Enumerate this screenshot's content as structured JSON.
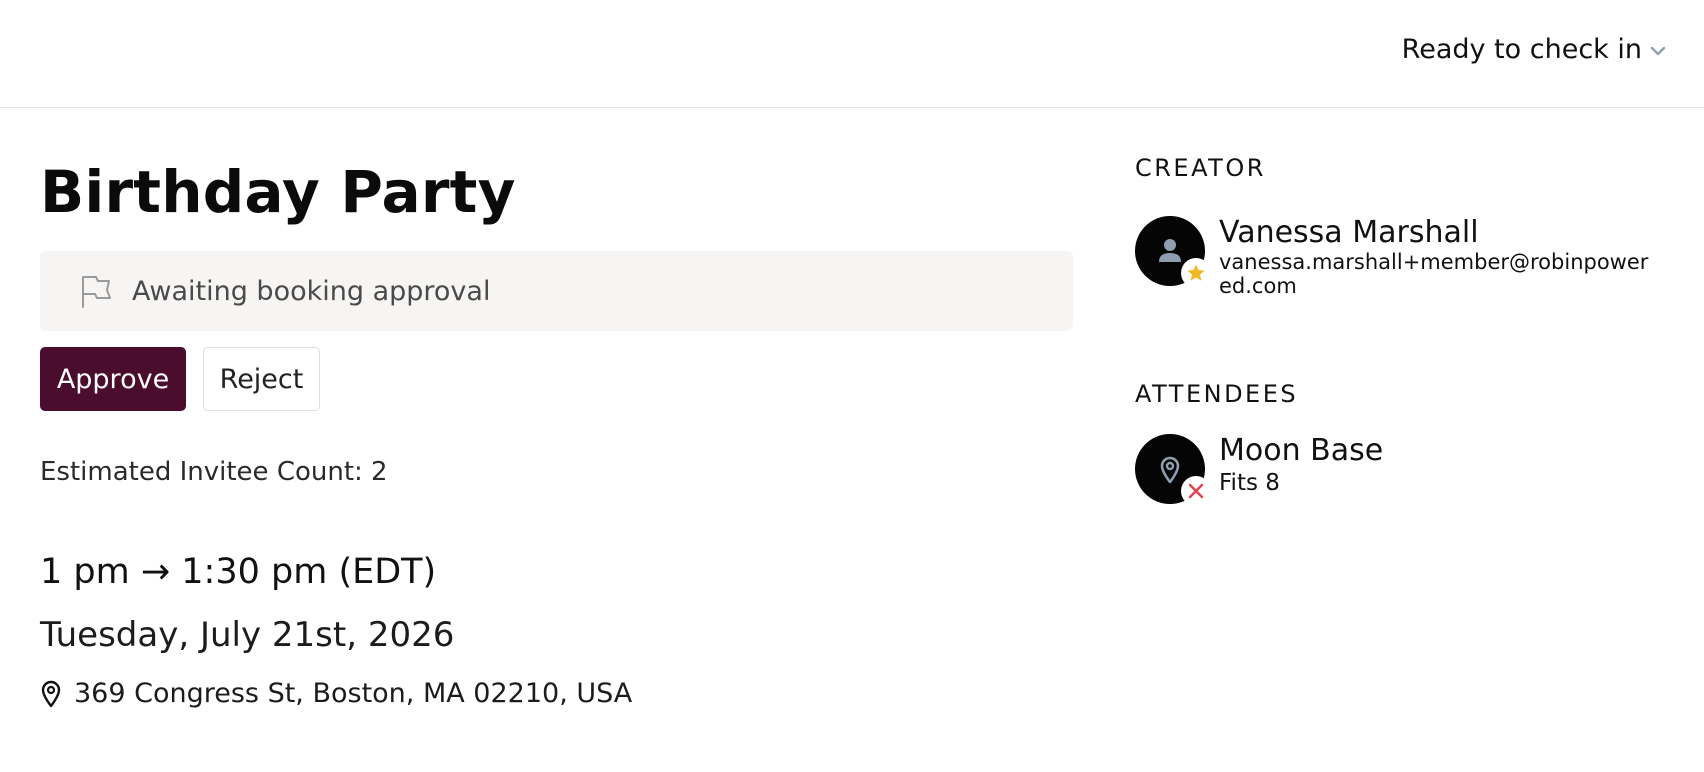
{
  "header": {
    "status_label": "Ready to check in",
    "status_icon": "chevron-down-icon"
  },
  "booking": {
    "title": "Birthday Party",
    "banner_text": "Awaiting booking approval",
    "banner_icon": "flag-icon",
    "approve_label": "Approve",
    "reject_label": "Reject",
    "invitee_count": "Estimated Invitee Count: 2",
    "time": "1 pm → 1:30 pm (EDT)",
    "date": "Tuesday, July 21st, 2026",
    "address": "369 Congress St, Boston, MA 02210, USA",
    "address_icon": "map-pin-icon"
  },
  "creator": {
    "section_label": "CREATOR",
    "name": "Vanessa Marshall",
    "email": "vanessa.marshall+member@robinpowered.com",
    "avatar_icon": "user-icon",
    "badge_icon": "star-icon"
  },
  "attendees": {
    "section_label": "ATTENDEES",
    "items": [
      {
        "name": "Moon Base",
        "subtitle": "Fits 8",
        "avatar_icon": "location-pin-icon",
        "badge_icon": "x-icon"
      }
    ]
  },
  "colors": {
    "approve_bg": "#4b0d2e",
    "banner_bg": "#f6f5f3",
    "star": "#f2b824",
    "decline_x": "#e0424e"
  }
}
